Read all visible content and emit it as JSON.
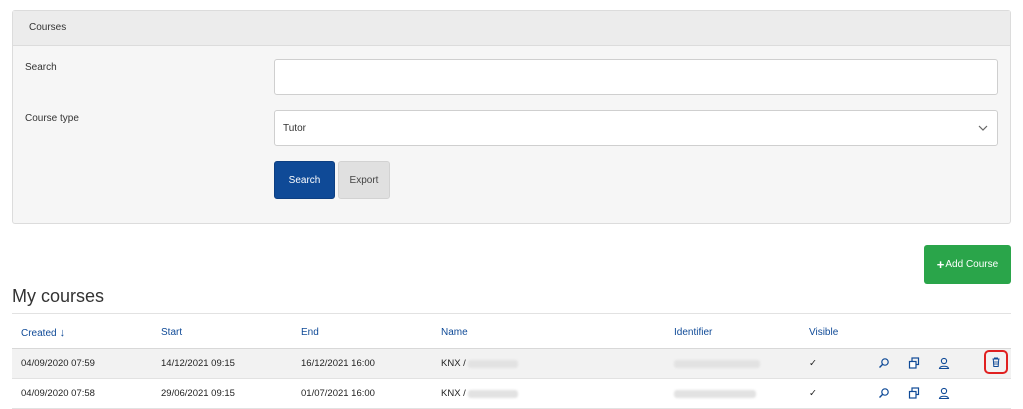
{
  "filter_panel": {
    "title": "Courses",
    "search_label": "Search",
    "search_value": "",
    "course_type_label": "Course type",
    "course_type_value": "Tutor",
    "search_button": "Search",
    "export_button": "Export"
  },
  "add_course_button": "Add Course",
  "page_title": "My courses",
  "table": {
    "columns": [
      "Created",
      "Start",
      "End",
      "Name",
      "Identifier",
      "Visible"
    ],
    "rows": [
      {
        "created": "04/09/2020 07:59",
        "start": "14/12/2021 09:15",
        "end": "16/12/2021 16:00",
        "name": "KNX /",
        "visible": "✓"
      },
      {
        "created": "04/09/2020 07:58",
        "start": "29/06/2021 09:15",
        "end": "01/07/2021 16:00",
        "name": "KNX /",
        "visible": "✓"
      }
    ]
  },
  "colors": {
    "primary": "#0f4a97",
    "success": "#2aa54a",
    "highlight": "#e02020"
  }
}
